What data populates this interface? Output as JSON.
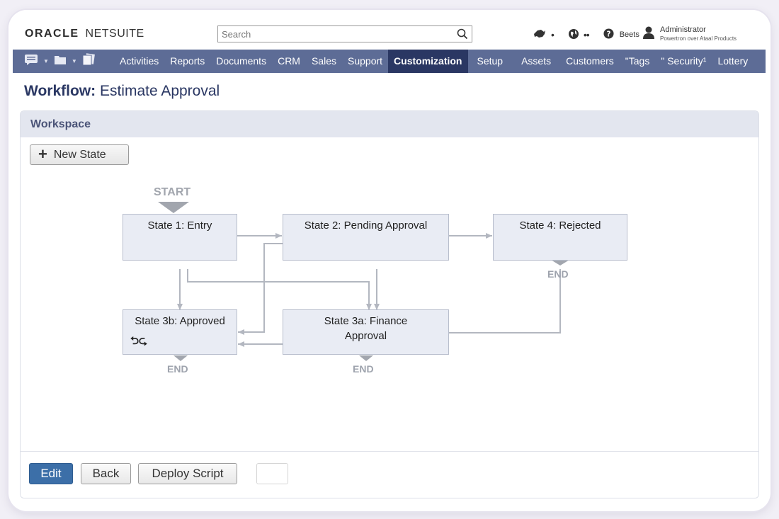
{
  "header": {
    "logo_oracle": "ORACLE",
    "logo_netsuite": "NETSUITE",
    "search_placeholder": "Search",
    "help_label": "Beets",
    "user_name": "Administrator",
    "user_role": "Powertron over Ataal Products"
  },
  "nav": {
    "items": [
      {
        "label": "Activities"
      },
      {
        "label": "Reports"
      },
      {
        "label": "Documents"
      },
      {
        "label": "CRM"
      },
      {
        "label": "Sales"
      },
      {
        "label": "Support"
      },
      {
        "label": "Customization"
      },
      {
        "label": "Setup"
      },
      {
        "label": "Assets"
      },
      {
        "label": "Customers"
      },
      {
        "label": "\"Tags"
      },
      {
        "label": "\" Security¹"
      },
      {
        "label": "Lottery"
      }
    ],
    "active": "Customization"
  },
  "page": {
    "title_bold": "Workflow:",
    "title_rest": "Estimate Approval"
  },
  "workspace": {
    "title": "Workspace",
    "new_state_label": "New State",
    "start_label": "START",
    "end_label": "END",
    "states": {
      "s1": "State 1: Entry",
      "s2": "State 2: Pending Approval",
      "s4": "State 4: Rejected",
      "s3b": "State 3b: Approved",
      "s3a_line1": "State 3a: Finance",
      "s3a_line2": "Approval"
    }
  },
  "footer": {
    "edit_label": "Edit",
    "back_label": "Back",
    "deploy_label": "Deploy Script"
  },
  "colors": {
    "nav_bg": "#5d6c96",
    "nav_active": "#2a3763",
    "primary_button": "#3c6fa8",
    "state_fill": "#e9ecf4"
  }
}
